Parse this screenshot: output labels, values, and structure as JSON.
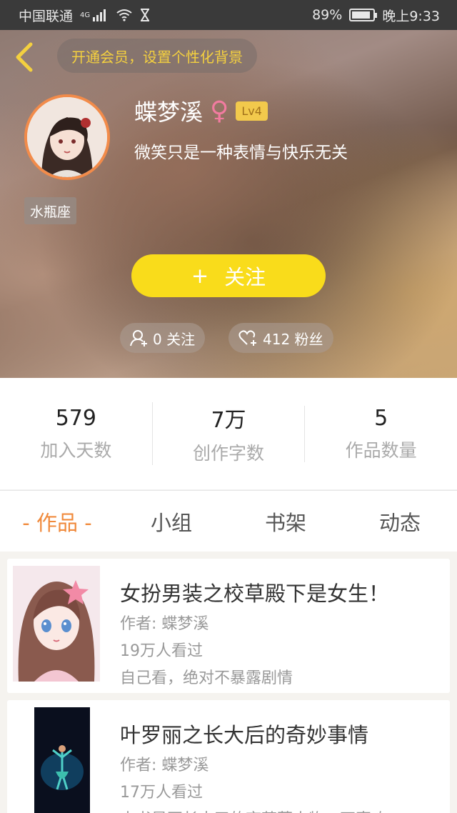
{
  "status_bar": {
    "carrier": "中国联通",
    "network": "4G",
    "battery_percent": "89%",
    "battery_level": 0.89,
    "time": "晚上9:33"
  },
  "header": {
    "vip_prompt": "开通会员，设置个性化背景",
    "username": "蝶梦溪",
    "gender_symbol": "♀",
    "level": "Lv4",
    "bio": "微笑只是一种表情与快乐无关",
    "zodiac": "水瓶座",
    "follow_plus": "+",
    "follow_label": "关注",
    "following_label": "0 关注",
    "fans_label": "412 粉丝"
  },
  "stats": [
    {
      "value": "579",
      "label": "加入天数"
    },
    {
      "value": "7万",
      "label": "创作字数"
    },
    {
      "value": "5",
      "label": "作品数量"
    }
  ],
  "tabs": [
    "作品",
    "小组",
    "书架",
    "动态"
  ],
  "works": [
    {
      "title": "女扮男装之校草殿下是女生！",
      "author": "作者: 蝶梦溪",
      "views": "19万人看过",
      "desc": "自己看，绝对不暴露剧情"
    },
    {
      "title": "叶罗丽之长大后的奇妙事情",
      "author": "作者: 蝶梦溪",
      "views": "17万人看过",
      "desc": "本书是写长大了的夜萝莉人物，不喜欢"
    }
  ],
  "colors": {
    "accent": "#f08a3c",
    "follow_button": "#f9dc1b",
    "vip_text": "#f4d03f",
    "gender": "#f27ba0"
  }
}
